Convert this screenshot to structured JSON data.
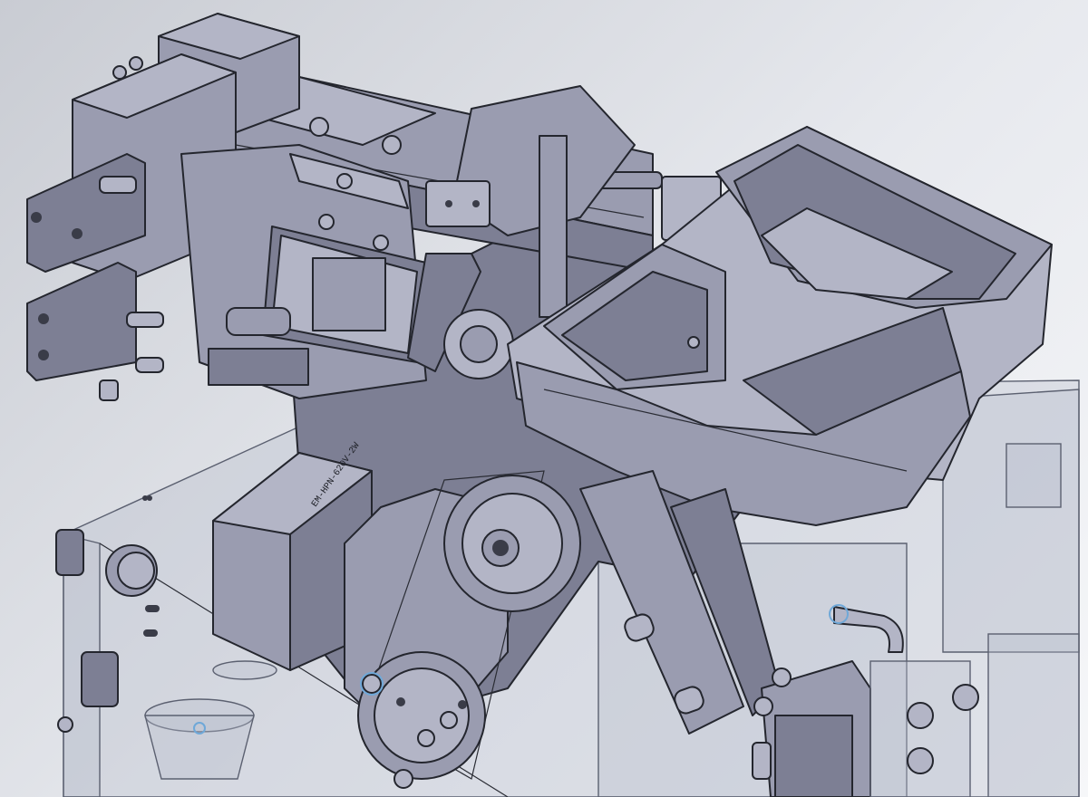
{
  "scene": {
    "motor_label": "EM-HPN-620V-2W"
  },
  "colors": {
    "background_dark": "#c9ccd3",
    "background_light": "#f6f7f9",
    "steel": "#9a9cb0",
    "edge": "#24262e",
    "accent_ring": "#6fa8d8"
  }
}
